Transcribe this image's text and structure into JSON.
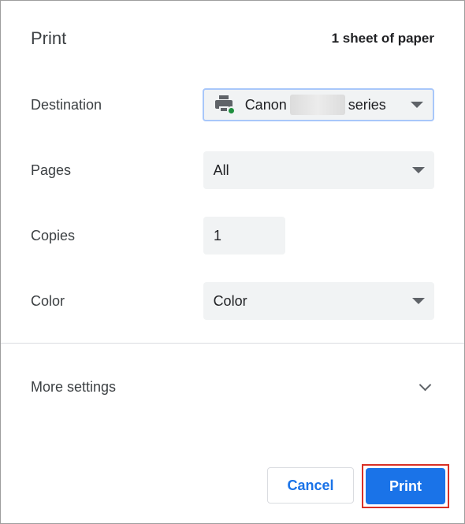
{
  "header": {
    "title": "Print",
    "sheet_count": "1 sheet of paper"
  },
  "destination": {
    "label": "Destination",
    "printer_name_prefix": "Canon",
    "printer_name_suffix": "series",
    "icon": "printer-online-icon"
  },
  "pages": {
    "label": "Pages",
    "value": "All"
  },
  "copies": {
    "label": "Copies",
    "value": "1"
  },
  "color": {
    "label": "Color",
    "value": "Color"
  },
  "more_settings": {
    "label": "More settings",
    "icon": "chevron-down-icon"
  },
  "buttons": {
    "cancel": "Cancel",
    "print": "Print"
  },
  "colors": {
    "accent": "#1a73e8",
    "highlight": "#d93025",
    "status_online": "#1e8e3e"
  }
}
